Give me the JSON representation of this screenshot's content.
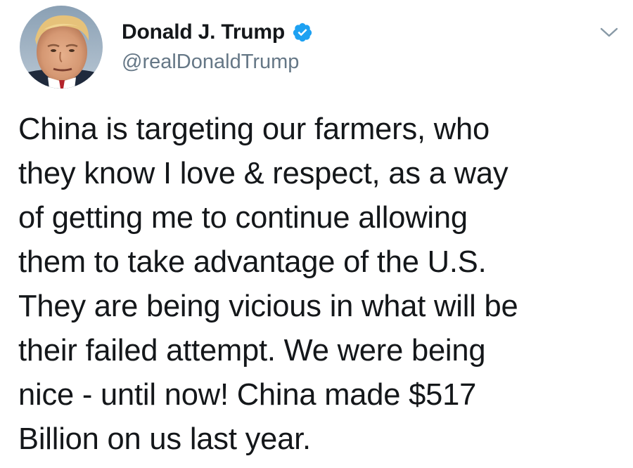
{
  "tweet": {
    "author": {
      "display_name": "Donald J. Trump",
      "handle": "@realDonaldTrump",
      "verified": true,
      "avatar_icon": "profile-photo"
    },
    "menu_icon": "chevron-down-icon",
    "text": "China is targeting our farmers, who\nthey know I love & respect, as a way\nof getting me to continue allowing\nthem to take advantage of the U.S.\nThey are being vicious in what will be\ntheir failed attempt. We were being\nnice - until now! China made $517\nBillion on us last year.",
    "colors": {
      "verified_badge": "#1da1f2",
      "text": "#14171a",
      "handle": "#657786",
      "caret": "#8899a6"
    }
  }
}
